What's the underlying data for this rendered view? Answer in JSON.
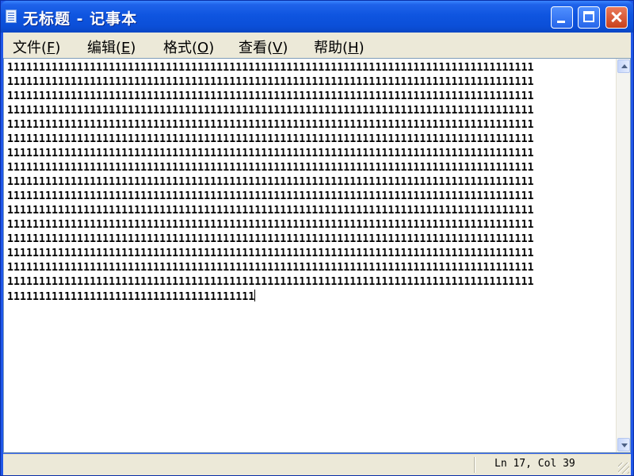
{
  "window": {
    "title": "无标题 - 记事本",
    "controls": {
      "minimize": "minimize",
      "maximize": "maximize",
      "close": "close"
    }
  },
  "menu": [
    {
      "label": "文件",
      "accel": "F"
    },
    {
      "label": "编辑",
      "accel": "E"
    },
    {
      "label": "格式",
      "accel": "O"
    },
    {
      "label": "查看",
      "accel": "V"
    },
    {
      "label": "帮助",
      "accel": "H"
    }
  ],
  "document": {
    "full_line_text": "11111111111111111111111111111111111111111111111111111111111111111111111111111111111",
    "full_line_count": 16,
    "last_line_text": "111111111111111111111111111111111111111"
  },
  "status": {
    "position": "Ln 17, Col 39"
  },
  "colors": {
    "titlebar": "#0b4fd8",
    "menubar": "#ece9d8",
    "editor_bg": "#ffffff",
    "close_button": "#c9401c"
  }
}
